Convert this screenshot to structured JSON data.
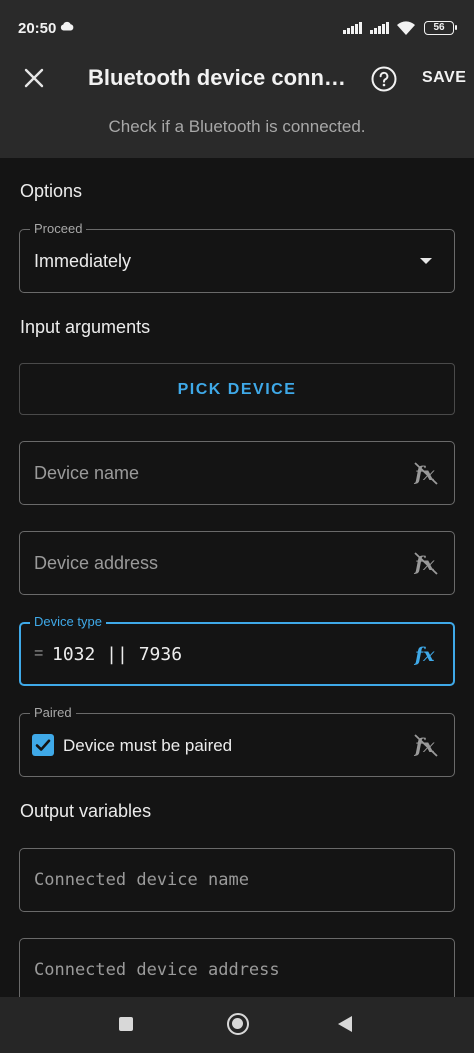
{
  "status_bar": {
    "time": "20:50",
    "battery": "56"
  },
  "toolbar": {
    "title": "Bluetooth device connected",
    "save_label": "SAVE",
    "subtitle": "Check if a Bluetooth is connected."
  },
  "options": {
    "section_title": "Options",
    "proceed": {
      "label": "Proceed",
      "value": "Immediately"
    }
  },
  "input_arguments": {
    "section_title": "Input arguments",
    "pick_device_label": "PICK DEVICE",
    "device_name": {
      "placeholder": "Device name"
    },
    "device_address": {
      "placeholder": "Device address"
    },
    "device_type": {
      "label": "Device type",
      "prefix": "=",
      "value": "1032 || 7936"
    },
    "paired": {
      "label": "Paired",
      "checkbox_label": "Device must be paired",
      "checked": true
    }
  },
  "output_variables": {
    "section_title": "Output variables",
    "connected_device_name": "Connected device name",
    "connected_device_address": "Connected device address"
  },
  "icons": {
    "close": "close-icon",
    "help": "help-circle-icon",
    "dropdown": "chevron-down-icon",
    "expression_off": "fx-off-icon",
    "expression_on": "fx-icon",
    "checkbox": "checkmark-icon"
  },
  "colors": {
    "accent": "#3fa9e8",
    "header_bg": "#2a2a2a",
    "page_bg": "#141414"
  }
}
